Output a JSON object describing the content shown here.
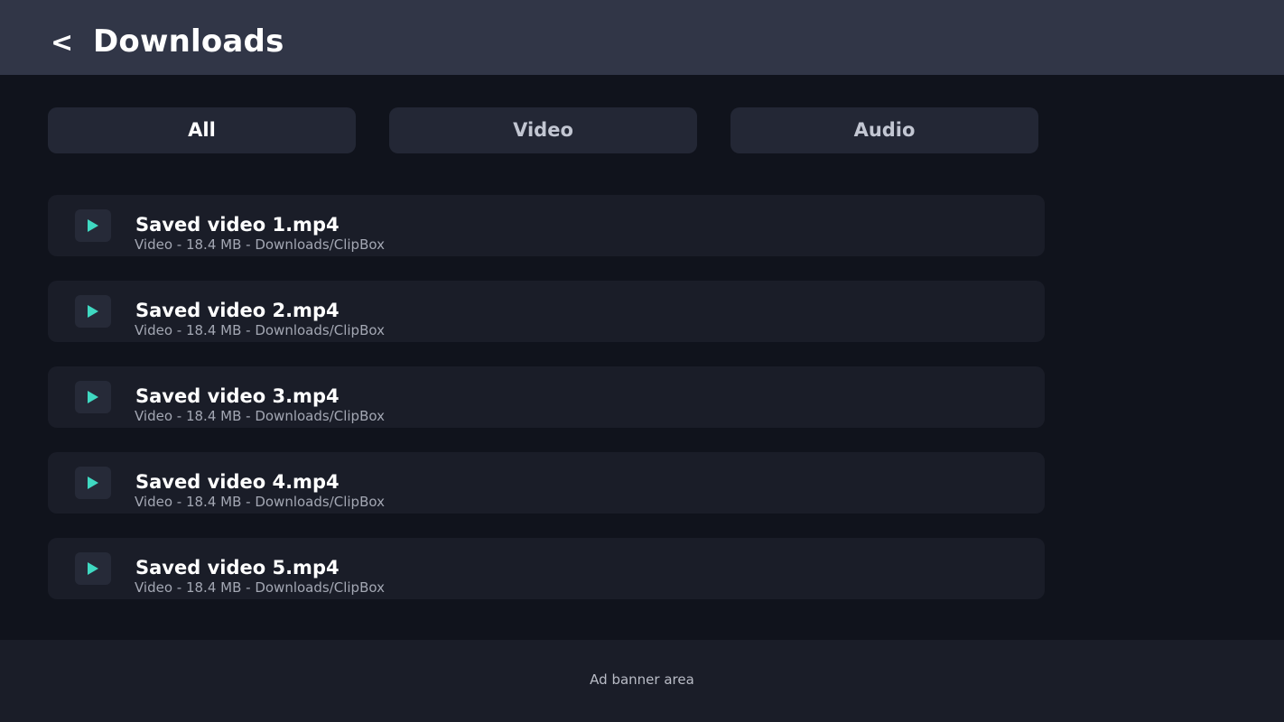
{
  "header": {
    "back_label": "<",
    "title": "Downloads"
  },
  "tabs": [
    {
      "label": "All",
      "active": true
    },
    {
      "label": "Video",
      "active": false
    },
    {
      "label": "Audio",
      "active": false
    }
  ],
  "downloads": [
    {
      "title": "Saved video 1.mp4",
      "meta": "Video - 18.4 MB - Downloads/ClipBox",
      "icon": "play-icon"
    },
    {
      "title": "Saved video 2.mp4",
      "meta": "Video - 18.4 MB - Downloads/ClipBox",
      "icon": "play-icon"
    },
    {
      "title": "Saved video 3.mp4",
      "meta": "Video - 18.4 MB - Downloads/ClipBox",
      "icon": "play-icon"
    },
    {
      "title": "Saved video 4.mp4",
      "meta": "Video - 18.4 MB - Downloads/ClipBox",
      "icon": "play-icon"
    },
    {
      "title": "Saved video 5.mp4",
      "meta": "Video - 18.4 MB - Downloads/ClipBox",
      "icon": "play-icon"
    }
  ],
  "ad": {
    "label": "Ad banner area"
  },
  "colors": {
    "accent": "#3fd9c2",
    "header_bg": "#313647",
    "page_bg": "#10131c",
    "card_bg": "#1a1d28"
  }
}
